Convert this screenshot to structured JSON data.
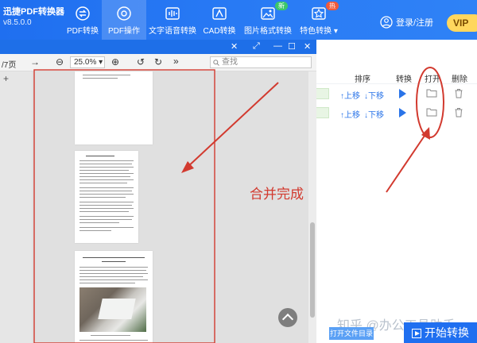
{
  "app": {
    "name": "迅捷PDF转换器",
    "version": "v8.5.0.0"
  },
  "nav": [
    {
      "label": "PDF转换"
    },
    {
      "label": "PDF操作"
    },
    {
      "label": "文字语音转换"
    },
    {
      "label": "CAD转换"
    },
    {
      "label": "图片格式转换",
      "badge": "新"
    },
    {
      "label": "特色转换 ▾",
      "badge": "热"
    }
  ],
  "user": {
    "login_label": "登录/注册",
    "vip_label": "VIP"
  },
  "viewer": {
    "page_suffix": "/7页",
    "zoom": "25.0%",
    "search_placeholder": "查找",
    "add_label": "+"
  },
  "table": {
    "headers": {
      "order": "排序",
      "convert": "转换",
      "open": "打开",
      "delete": "删除"
    },
    "rows": [
      {
        "up": "↑上移",
        "down": "↓下移"
      },
      {
        "up": "↑上移",
        "down": "↓下移"
      }
    ]
  },
  "buttons": {
    "open_folder": "打开文件目录",
    "start": "开始转换"
  },
  "annotation": {
    "text": "合并完成",
    "color": "#d23a2f"
  },
  "watermark": "知乎 @办公工具助手",
  "colors": {
    "brand_blue": "#1f6ff0",
    "vip_gold": "#ffd75e"
  }
}
